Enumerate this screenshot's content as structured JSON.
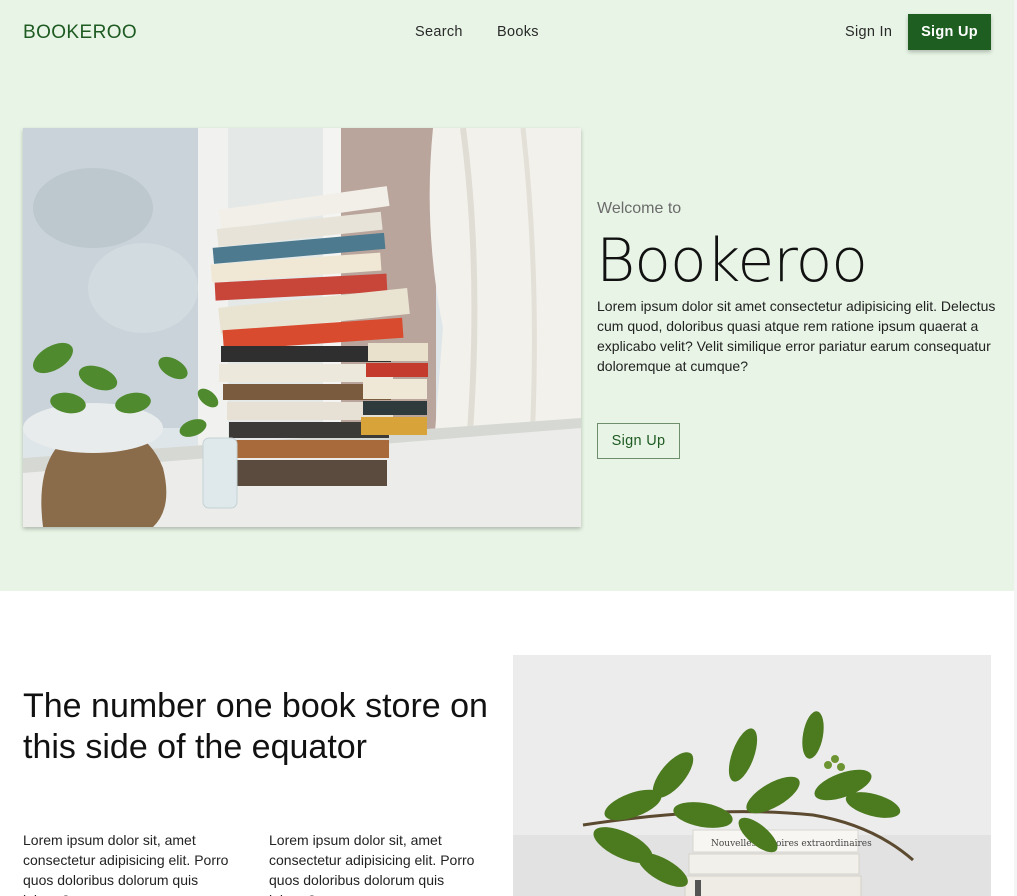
{
  "nav": {
    "brand": "BOOKEROO",
    "links": [
      "Search",
      "Books"
    ],
    "sign_in": "Sign In",
    "sign_up": "Sign Up"
  },
  "hero": {
    "welcome": "Welcome to",
    "title": "Bookeroo",
    "description": "Lorem ipsum dolor sit amet consectetur adipisicing elit. Delectus cum quod, doloribus quasi atque rem ratione ipsum quaerat a explicabo velit? Velit similique error pariatur earum consequatur doloremque at cumque?",
    "cta": "Sign Up",
    "image": "stack-of-books-on-windowsill-photo"
  },
  "feature": {
    "title": "The number one book store on this side of the equator",
    "columns": [
      "Lorem ipsum dolor sit, amet consectetur adipisicing elit. Porro quos doloribus dolorum quis labore?",
      "Lorem ipsum dolor sit, amet consectetur adipisicing elit. Porro quos doloribus dolorum quis labore?"
    ],
    "image": "books-with-green-leaves-photo",
    "book_spine_text": "Nouvelles histoires extraordinaires"
  },
  "colors": {
    "hero_background": "#e8f5e6",
    "brand_green": "#1e5e20",
    "outline_border": "#6f8f6c"
  }
}
